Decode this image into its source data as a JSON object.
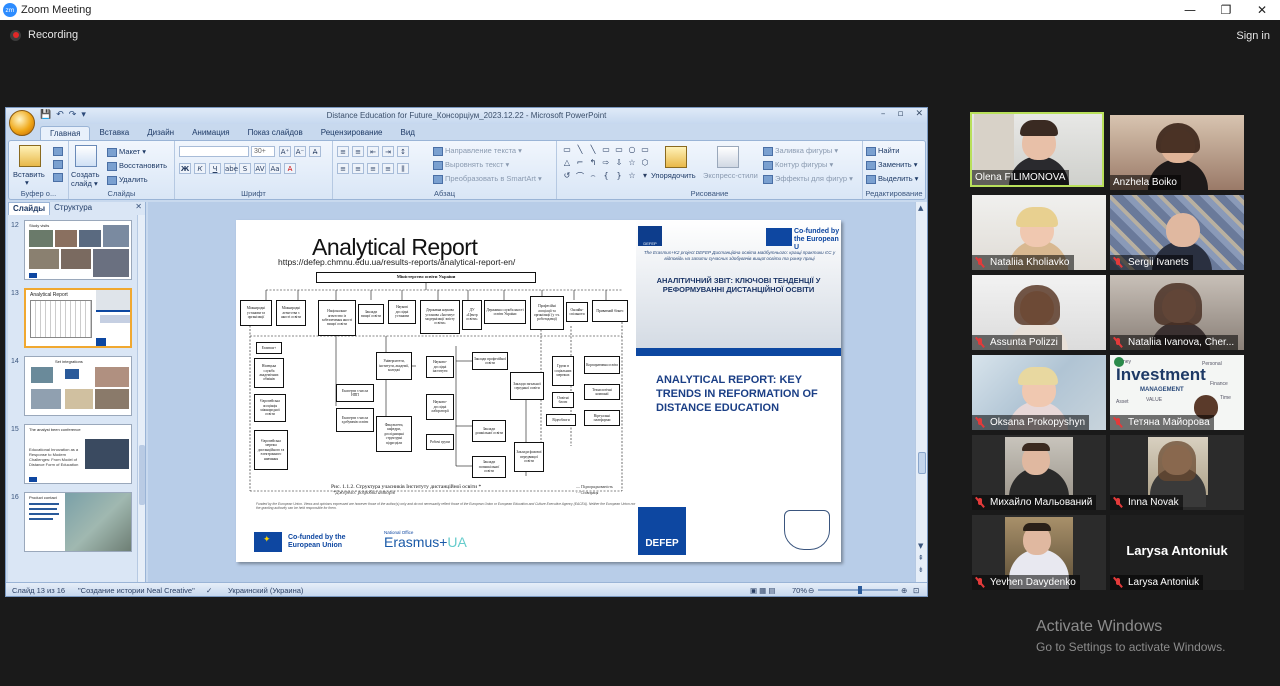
{
  "zoom": {
    "app_title": "Zoom Meeting",
    "logo_text": "zm",
    "recording_label": "Recording",
    "sign_in": "Sign in",
    "window_buttons": [
      "—",
      "❐",
      "✕"
    ]
  },
  "ppt": {
    "window_title": "Distance Education for Future_Консорціум_2023.12.22 - Microsoft PowerPoint",
    "window_buttons": [
      "–",
      "▫",
      "✕"
    ],
    "qat": [
      "💾",
      "↶",
      "↷",
      "▾"
    ],
    "tabs": [
      "Главная",
      "Вставка",
      "Дизайн",
      "Анимация",
      "Показ слайдов",
      "Рецензирование",
      "Вид"
    ],
    "ribbon": {
      "clipboard": {
        "label": "Буфер о...",
        "paste": "Вставить",
        "paste_sub": "▾"
      },
      "slides": {
        "label": "Слайды",
        "new_slide": "Создать",
        "new_slide_sub": "слайд ▾",
        "layout": "Макет ▾",
        "reset": "Восстановить",
        "delete": "Удалить"
      },
      "font": {
        "label": "Шрифт",
        "font_size": "30+",
        "bold": "Ж",
        "italic": "К",
        "underline": "Ч",
        "strike": "abe",
        "shadow": "S",
        "spacing": "AV",
        "case": "Aa",
        "color": "A",
        "grow": "A⁺",
        "shrink": "A⁻",
        "clear": "A̶"
      },
      "paragraph": {
        "label": "Абзац",
        "direction": "Направление текста ▾",
        "align_text": "Выровнять текст ▾",
        "smartart": "Преобразовать в SmartArt ▾"
      },
      "drawing": {
        "label": "Рисование",
        "arrange": "Упорядочить",
        "quick_styles": "Экспресс-стили",
        "fill": "Заливка фигуры ▾",
        "outline": "Контур фигуры ▾",
        "effects": "Эффекты для фигур ▾"
      },
      "editing": {
        "label": "Редактирование",
        "find": "Найти",
        "replace": "Заменить ▾",
        "select": "Выделить ▾"
      }
    },
    "pane_tabs": {
      "slides": "Слайды",
      "outline": "Структура",
      "close": "✕"
    },
    "thumbnails": [
      {
        "num": "12",
        "title": "Study visits"
      },
      {
        "num": "13",
        "title": "Analytical Report"
      },
      {
        "num": "14",
        "title": "Set integrations"
      },
      {
        "num": "15",
        "title": "The analyst been conference",
        "text": "Educational Innovation as a Response to Modern Challenges: From Model of Distance Form of Education"
      },
      {
        "num": "16",
        "title": "Product contact"
      }
    ],
    "status": {
      "slide": "Слайд 13 из 16",
      "theme": "\"Создание истории Neal Creative\"",
      "language": "Украинский (Украина)",
      "zoom": "70%",
      "views": "▣ ▦ ▤",
      "zoom_out": "⊖",
      "zoom_in": "⊕",
      "fit": "⊡"
    }
  },
  "slide": {
    "title": "Analytical Report",
    "url": "https://defep.chmnu.edu.ua/results-reports/analytical-report-en/",
    "diagram": {
      "top": "Міністерство освіти України",
      "row1": [
        "Міжнародні установи та організації",
        "Міжнародні агентства з якості освіти",
        "Національне агентство із забезпечення якості вищої освіти",
        "Заклади вищої освіти",
        "Наукові дослідні установи",
        "Державна наукова установа «Інститут модернізації змісту освіти»",
        "ДУ «Центр освіти»",
        "Державна служба якості освіти України",
        "Професійні асоціації та організації (у т.ч. роботодавці)",
        "Онлайн-спільноти",
        "Приватний бізнес"
      ],
      "col1": [
        "Erasmus+",
        "Німецька служба академічних обмінів",
        "Європейська асоціація міжнародної освіти",
        "Європейська мережа дистанційного та електронного навчання"
      ],
      "mid": [
        "Експерти з числа НПП",
        "Експерти з числа здобувачів освіти",
        "Університети, інститути, академії, коледжі",
        "Факультети, кафедри, дослідницькі структурні підрозділи",
        "Науково-дослідні інститути",
        "Науково-дослідні лабораторії",
        "Робочі групи",
        "Заклади професійної освіти",
        "Заклади загальної середньої освіти",
        "Заклади дошкільної освіти",
        "Заклади позашкільної освіти",
        "Заклади фахової передвищої освіти",
        "Групи в соціальних мережах",
        "Освітні блоги",
        "Відеоблоги",
        "Корпоративна освіта",
        "Технологічні компанії",
        "Віртуальні платформи"
      ],
      "caption": "Рис. 1.1.2. Структура учасників Інституту дистанційної освіти *",
      "caption_note": "*Джерело: розробка авторів",
      "legend": [
        "Підпорядкованість",
        "Співпраця"
      ]
    },
    "disclaimer": "Funded by the European Union. Views and opinions expressed are however those of the author(s) only and do not necessarily reflect those of the European Union or European Education and Culture Executive Agency (EACEA). Neither the European Union nor the granting authority can be held responsible for them.",
    "cofund": "Co-funded by the European Union",
    "national_office": "National Office",
    "erasmus": "Erasmus+",
    "erasmus_ua": "UA",
    "right": {
      "logo_small": "DEFEP",
      "cofund": "Co-funded by the European U",
      "italic": "The Erasmus+K2 project DEFEP Дистанційна освіта майбутнього: кращі практики ЄС у відповідь на запити сучасних здобувачів вищої освіти та ринку праці",
      "headline": "АНАЛІТИЧНИЙ ЗВІТ: КЛЮЧОВІ ТЕНДЕНЦІЇ У РЕФОРМУВАННІ ДИСТАНЦІЙНОЇ ОСВІТИ",
      "big": "ANALYTICAL REPORT: KEY TRENDS IN REFORMATION OF DISTANCE EDUCATION",
      "defep": "DEFEP"
    }
  },
  "participants": [
    {
      "name": "Olena FILIMONOVA",
      "muted": false,
      "active": true
    },
    {
      "name": "Anzhela Boiko",
      "muted": false
    },
    {
      "name": "Nataliia Kholiavko",
      "muted": true
    },
    {
      "name": "Sergii Ivanets",
      "muted": true
    },
    {
      "name": "Assunta Polizzi",
      "muted": true
    },
    {
      "name": "Nataliia Ivanova, Cher...",
      "muted": true
    },
    {
      "name": "Oksana Prokopyshyn",
      "muted": true
    },
    {
      "name": "Тетяна Майорова",
      "muted": true,
      "banner": "Investment",
      "banner_sub": "MANAGEMENT",
      "words": [
        "Personal",
        "VALUE",
        "Finance",
        "Asset",
        "Time",
        "Money"
      ]
    },
    {
      "name": "Михайло Мальований",
      "muted": true
    },
    {
      "name": "Inna Novak",
      "muted": true
    },
    {
      "name": "Yevhen Davydenko",
      "muted": true
    },
    {
      "name": "Larysa Antoniuk",
      "muted": true,
      "avatar_text": "Larysa Antoniuk"
    }
  ],
  "activate": {
    "title": "Activate Windows",
    "sub": "Go to Settings to activate Windows."
  }
}
